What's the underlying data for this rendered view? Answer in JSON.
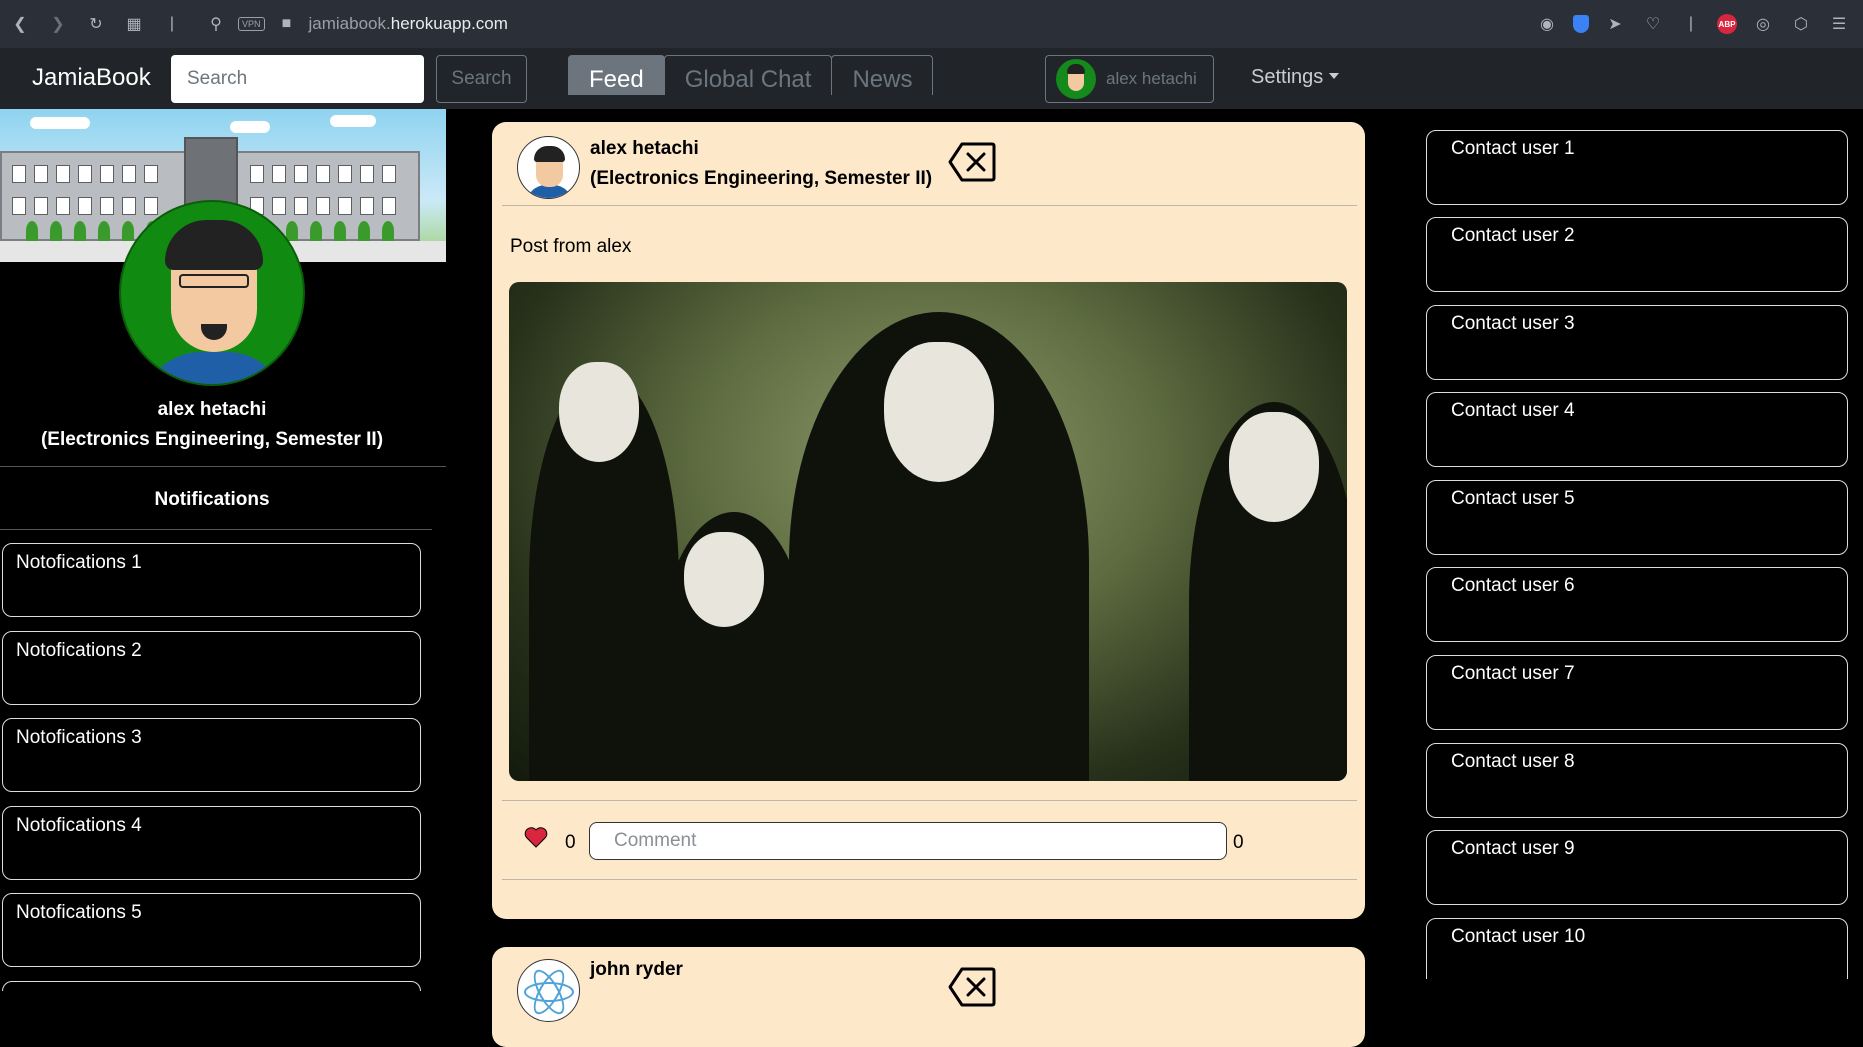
{
  "browser": {
    "url_prefix": "jamiabook.",
    "url_host": "herokuapp.com",
    "vpn_label": "VPN",
    "abp_label": "ABP"
  },
  "navbar": {
    "brand": "JamiaBook",
    "search_placeholder": "Search",
    "search_button": "Search",
    "tabs": [
      {
        "label": "Feed",
        "active": true
      },
      {
        "label": "Global Chat",
        "active": false
      },
      {
        "label": "News",
        "active": false
      }
    ],
    "user_name": "alex hetachi",
    "settings_label": "Settings"
  },
  "profile": {
    "name": "alex hetachi",
    "program": "(Electronics Engineering, Semester II)"
  },
  "notifications": {
    "title": "Notifications",
    "items": [
      "Notofications 1",
      "Notofications 2",
      "Notofications 3",
      "Notofications 4",
      "Notofications 5"
    ]
  },
  "feed": {
    "posts": [
      {
        "author": "alex hetachi",
        "program": "(Electronics Engineering, Semester II)",
        "text": "Post from alex",
        "likes": "0",
        "comment_placeholder": "Comment",
        "comments": "0"
      },
      {
        "author": "john ryder"
      }
    ]
  },
  "contacts": {
    "items": [
      "Contact user 1",
      "Contact user 2",
      "Contact user 3",
      "Contact user 4",
      "Contact user 5",
      "Contact user 6",
      "Contact user 7",
      "Contact user 8",
      "Contact user 9",
      "Contact user 10"
    ]
  },
  "colors": {
    "post_bg": "#fde8c9",
    "navbar_bg": "#212529",
    "browser_bg": "#2b2f38",
    "heart": "#d7263d",
    "avatar_green": "#118a12"
  }
}
